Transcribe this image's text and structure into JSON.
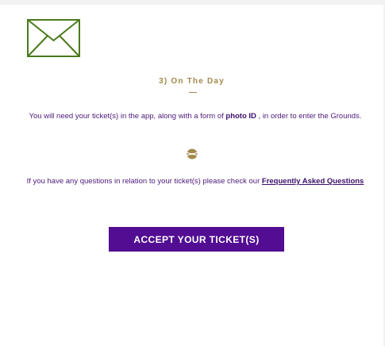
{
  "icons": {
    "mail": "envelope-icon",
    "divider": "tennis-ball-icon"
  },
  "section": {
    "title": "3) On The Day"
  },
  "paragraph1": {
    "text_before": "You will need your ticket(s) in the app, along with a form of ",
    "bold": "photo ID",
    "text_after": " , in order to enter the Grounds."
  },
  "paragraph2": {
    "text_before": "If you have any questions in relation to your ticket(s) please check our ",
    "link": "Frequently Asked Questions"
  },
  "cta": {
    "label": "ACCEPT YOUR TICKET(S)"
  },
  "colors": {
    "accent_gold": "#a28a4c",
    "icon_green": "#4a7a1a",
    "brand_purple": "#520d92",
    "text_purple": "#4b1a7a"
  }
}
